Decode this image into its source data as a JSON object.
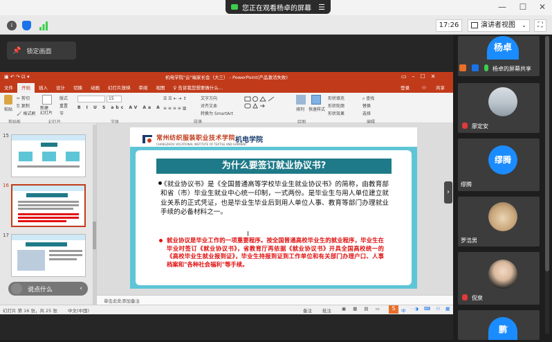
{
  "os": {
    "share_banner": "您正在观看杨卓的屏幕"
  },
  "meeting_toolbar": {
    "time": "17:26",
    "view_mode": "演讲者视图"
  },
  "screen": {
    "lock_label": "锁定画面",
    "speak_label": "说点什么",
    "side_arrow": "›"
  },
  "ppt": {
    "window_title": "机电学院\"云\"端家长会（大三） - PowerPoint(产品激活失败)",
    "menu_tabs": [
      "文件",
      "开始",
      "插入",
      "设计",
      "切换",
      "动画",
      "幻灯片放映",
      "审阅",
      "视图",
      "♀ 告诉我您想要做什么..."
    ],
    "active_tab": "开始",
    "login": "登录",
    "share": "共享",
    "ribbon": {
      "paste": "粘贴",
      "cut": "剪切",
      "copy": "复制",
      "format_painter": "格式刷",
      "new_slide": "新建\n幻灯片",
      "layout": "版式",
      "reset": "重置",
      "section": "节",
      "font_size": "15",
      "text_direction": "文字方向",
      "align_text": "对齐文本",
      "to_smartart": "转换为 SmartArt",
      "arrange": "排列",
      "quick_styles": "快速样式",
      "shape_fill": "形状填充",
      "shape_outline": "形状轮廓",
      "shape_effect": "形状效果",
      "find": "查找",
      "replace": "替换",
      "select": "选择",
      "groups": [
        "剪贴板",
        "幻灯片",
        "字体",
        "段落",
        "绘图",
        "编辑"
      ]
    },
    "thumbnails": [
      {
        "num": "15",
        "selected": false
      },
      {
        "num": "16",
        "selected": true
      },
      {
        "num": "17",
        "selected": false
      }
    ],
    "slide": {
      "logo_text": "常州纺织服装职业技术学院",
      "logo_sub": "CHANGZHOU VOCATIONAL INSTITUTE OF TEXTILE AND GARMENT",
      "dept": "机电学院",
      "title": "为什么要签订就业协议书?",
      "bullet1": "《就业协议书》是《全国普通高等学校毕业生就业协议书》的简称，由教育部和省（市）毕业生就业中心统一印制，一式两份。是毕业生与用人单位建立就业关系的正式凭证，也是毕业生毕业后到用人单位人事、教育等部门办理就业手续的必备材料之一。",
      "bullet2": "就业协议是毕业工作的一项重要程序。按全国普通高校毕业生的就业程序，毕业生在毕业时签订《就业协议书》，省教育厅再依据《就业协议书》开具全国高校统一的《高校毕业生就业报到证》，毕业生持报到证到工作单位和有关部门办理户口、人事档案和\"各种社会福利\"等手续。"
    },
    "notes_placeholder": "单击此处添加备注",
    "status": {
      "slide_count": "幻灯片 第 16 张，共 25 张",
      "language": "中文(中国)",
      "notes_btn": "备注",
      "comments_btn": "批注",
      "ime": "中"
    }
  },
  "participants": [
    {
      "name": "杨卓",
      "label": "杨卓的屏幕共享",
      "avatar_text": "杨卓",
      "kind": "text",
      "color": "#1a8cff",
      "muted": false
    },
    {
      "name": "廖定安",
      "avatar_text": "",
      "kind": "photo-sky",
      "muted": true
    },
    {
      "name": "缪腾",
      "avatar_text": "缪腾",
      "kind": "text",
      "color": "#1a8cff",
      "muted": false
    },
    {
      "name": "罗浩男",
      "avatar_text": "",
      "kind": "photo-cat",
      "muted": false
    },
    {
      "name": "倪泉",
      "avatar_text": "",
      "kind": "photo-person",
      "muted": true
    },
    {
      "name": "鹏",
      "avatar_text": "鹏",
      "kind": "text",
      "color": "#1a8cff",
      "muted": false
    }
  ]
}
